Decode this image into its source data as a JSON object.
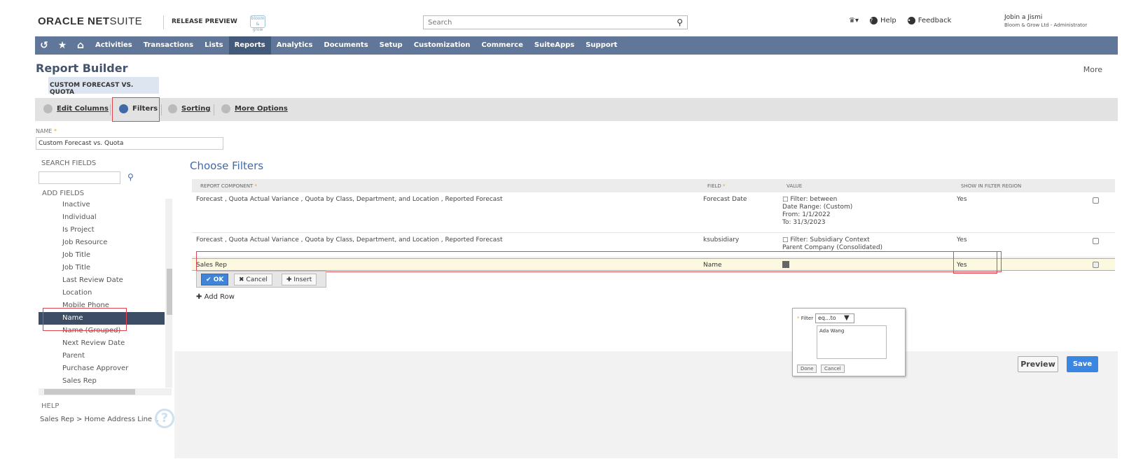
{
  "header": {
    "logo_bold": "ORACLE NET",
    "logo_light": "SUITE",
    "release": "RELEASE PREVIEW",
    "brand_logo": "bloom & grow",
    "search_placeholder": "Search",
    "help": "Help",
    "feedback": "Feedback",
    "user_name": "Jobin a Jismi",
    "user_role": "Bloom & Grow Ltd - Administrator"
  },
  "nav": {
    "items": [
      "Activities",
      "Transactions",
      "Lists",
      "Reports",
      "Analytics",
      "Documents",
      "Setup",
      "Customization",
      "Commerce",
      "SuiteApps",
      "Support"
    ],
    "active": "Reports"
  },
  "page": {
    "title": "Report Builder",
    "more": "More",
    "report_tag": "CUSTOM FORECAST VS. QUOTA"
  },
  "tabs": [
    "Edit Columns",
    "Filters",
    "Sorting",
    "More Options"
  ],
  "name_field": {
    "label": "NAME",
    "value": "Custom Forecast vs. Quota"
  },
  "left_panel": {
    "search_label": "SEARCH FIELDS",
    "add_label": "ADD FIELDS",
    "fields": [
      "Inactive",
      "Individual",
      "Is Project",
      "Job Resource",
      "Job Title",
      "Job Title",
      "Last Review Date",
      "Location",
      "Mobile Phone",
      "Name",
      "Name (Grouped)",
      "Next Review Date",
      "Parent",
      "Purchase Approver",
      "Sales Rep"
    ],
    "selected": "Name",
    "help_label": "HELP",
    "help_text": "Sales Rep > Home Address Line 1"
  },
  "filters": {
    "heading": "Choose Filters",
    "col_component": "REPORT COMPONENT",
    "col_field": "FIELD",
    "col_value": "VALUE",
    "col_show": "SHOW IN FILTER REGION",
    "rows": [
      {
        "component": "Forecast , Quota Actual Variance , Quota by Class, Department, and Location , Reported Forecast",
        "field": "Forecast Date",
        "value_lines": [
          "Filter: between",
          "Date Range: (Custom)",
          "From: 1/1/2022",
          "To: 31/3/2023"
        ],
        "show": "Yes"
      },
      {
        "component": "Forecast , Quota Actual Variance , Quota by Class, Department, and Location , Reported Forecast",
        "field": "ksubsidiary",
        "value_lines": [
          "Filter: Subsidiary Context",
          "Parent Company (Consolidated)"
        ],
        "show": "Yes"
      }
    ],
    "edit_row": {
      "component": "Sales Rep",
      "field": "Name",
      "show": "Yes"
    },
    "buttons": {
      "ok": "OK",
      "cancel": "Cancel",
      "insert": "Insert"
    },
    "add_row": "Add Row"
  },
  "popup": {
    "label": "Filter",
    "select": "eq...to",
    "text": "Ada Wang",
    "done": "Done",
    "cancel": "Cancel"
  },
  "actions": {
    "preview": "Preview",
    "save": "Save"
  }
}
